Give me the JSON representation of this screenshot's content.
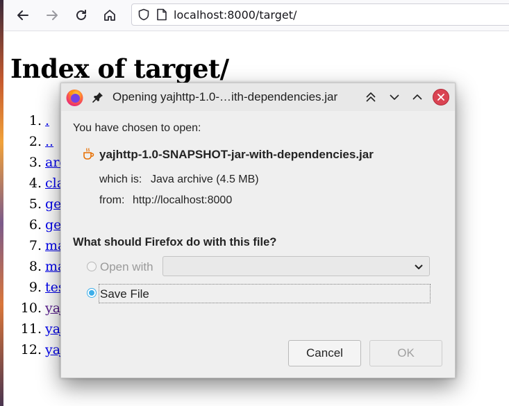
{
  "browser": {
    "url": "localhost:8000/target/",
    "icons": [
      "back-arrow-icon",
      "forward-arrow-icon",
      "reload-icon",
      "home-icon",
      "shield-icon",
      "page-icon"
    ]
  },
  "page": {
    "title": "Index of target/",
    "items": [
      {
        "num": "1.",
        "label": "."
      },
      {
        "num": "2.",
        "label": ".."
      },
      {
        "num": "3.",
        "label": "arc"
      },
      {
        "num": "4.",
        "label": "cla"
      },
      {
        "num": "5.",
        "label": "ge"
      },
      {
        "num": "6.",
        "label": "ge"
      },
      {
        "num": "7.",
        "label": "ma"
      },
      {
        "num": "8.",
        "label": "ma"
      },
      {
        "num": "9.",
        "label": "tes"
      },
      {
        "num": "10.",
        "label": "yaj"
      },
      {
        "num": "11.",
        "label": "yaj"
      },
      {
        "num": "12.",
        "label": "yaj"
      }
    ]
  },
  "dialog": {
    "title": "Opening yajhttp-1.0-…ith-dependencies.jar",
    "chosen_label": "You have chosen to open:",
    "file_name": "yajhttp-1.0-SNAPSHOT-jar-with-dependencies.jar",
    "which_is_label": "which is:",
    "which_is_value": "Java archive (4.5 MB)",
    "from_label": "from:",
    "from_value": "http://localhost:8000",
    "question": "What should Firefox do with this file?",
    "open_with_label": "Open with",
    "open_with_value": "",
    "save_file_label": "Save File",
    "cancel_label": "Cancel",
    "ok_label": "OK",
    "colors": {
      "accent": "#3daee9",
      "close": "#da4453"
    }
  }
}
